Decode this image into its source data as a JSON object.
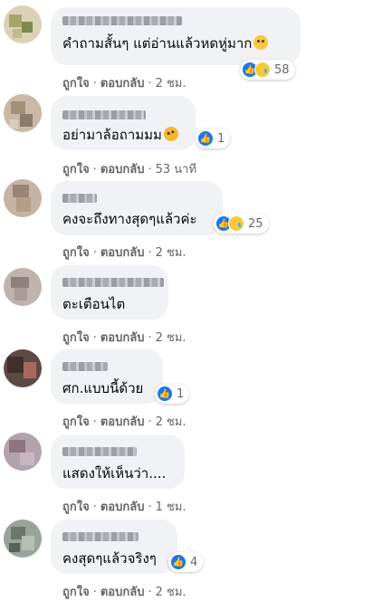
{
  "actions": {
    "like": "ถูกใจ",
    "reply": "ตอบกลับ",
    "dot": "·"
  },
  "comments": [
    {
      "text": "คำถามสั้นๆ แต่อ่านแล้วหดหู่มาก",
      "emoji": "sad-face-emoji",
      "reactions": {
        "icons": [
          "like-icon",
          "sad-icon"
        ],
        "count": "58"
      },
      "time": "2 ชม."
    },
    {
      "text": "อย่ามาล้อถามมม",
      "emoji": "laughing-face-emoji",
      "reactions": {
        "icons": [
          "like-icon"
        ],
        "count": "1"
      },
      "time": "53 นาที"
    },
    {
      "text": "คงจะถึงทางสุดๆแล้วค่ะ",
      "emoji": "",
      "reactions": {
        "icons": [
          "like-icon",
          "sad-icon"
        ],
        "count": "25"
      },
      "time": "2 ชม."
    },
    {
      "text": "ตะเตือนไต",
      "emoji": "",
      "reactions": null,
      "time": "2 ชม."
    },
    {
      "text": "ศก.แบบนี้ด้วย",
      "emoji": "",
      "reactions": {
        "icons": [
          "like-icon"
        ],
        "count": "1"
      },
      "time": "2 ชม."
    },
    {
      "text": "แสดงให้เห็นว่า....",
      "emoji": "",
      "reactions": null,
      "time": "1 ชม."
    },
    {
      "text": "คงสุดๆแล้วจริงๆ",
      "emoji": "",
      "reactions": {
        "icons": [
          "like-icon"
        ],
        "count": "4"
      },
      "time": "2 ชม."
    }
  ],
  "colors": {
    "bubble": "#f0f2f5",
    "like": "#1877f2",
    "secondary_text": "#65676b"
  }
}
